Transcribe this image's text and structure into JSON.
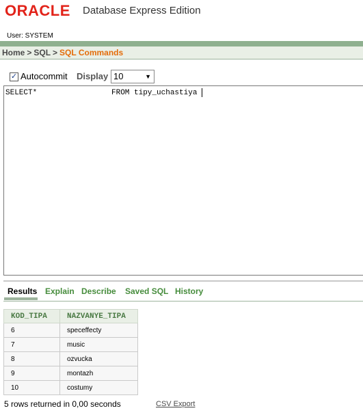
{
  "header": {
    "logo_text": "ORACLE",
    "edition": "Database Express Edition",
    "user_label": "User: SYSTEM"
  },
  "breadcrumb": {
    "items": [
      "Home",
      "SQL",
      "SQL Commands"
    ],
    "separator": ">"
  },
  "toolbar": {
    "autocommit_label": "Autocommit",
    "autocommit_checked": true,
    "display_label": "Display",
    "display_value": "10"
  },
  "editor": {
    "text_part1": "SELECT*",
    "text_part2": "FROM tipy_uchastiya"
  },
  "tabs": [
    "Results",
    "Explain",
    "Describe",
    "Saved SQL",
    "History"
  ],
  "results": {
    "columns": [
      "KOD_TIPA",
      "NAZVANYE_TIPA"
    ],
    "rows": [
      [
        "6",
        "speceffecty"
      ],
      [
        "7",
        "music"
      ],
      [
        "8",
        "ozvucka"
      ],
      [
        "9",
        "montazh"
      ],
      [
        "10",
        "costumy"
      ]
    ],
    "summary": "5 rows returned in 0,00 seconds",
    "csv_label": "CSV Export"
  },
  "colors": {
    "brand_red": "#e2231a",
    "link_green": "#468c3c",
    "breadcrumb_orange": "#e46c0a",
    "header_green": "#8fb08f"
  }
}
